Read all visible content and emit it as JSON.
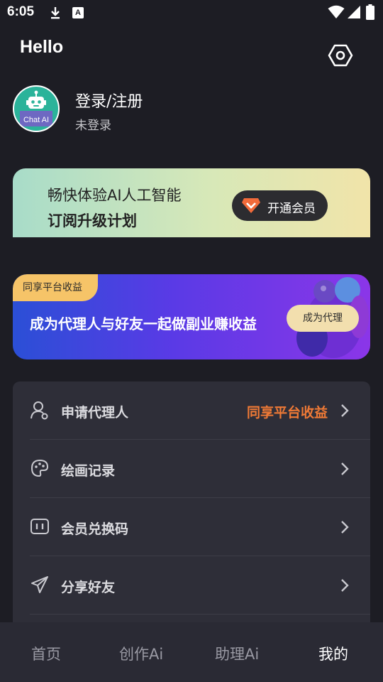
{
  "status_bar": {
    "time": "6:05",
    "icons": [
      "download-icon",
      "a-badge-icon",
      "wifi-icon",
      "signal-icon",
      "battery-icon"
    ],
    "a_glyph": "A"
  },
  "header": {
    "title": "Hello",
    "settings_icon": "hexagon-settings-icon"
  },
  "profile": {
    "avatar_label": "Chat AI",
    "login_title": "登录/注册",
    "login_status": "未登录"
  },
  "vip_banner": {
    "line1": "畅快体验AI人工智能",
    "line2": "订阅升级计划",
    "button_label": "开通会员",
    "accent": "#f26b3a"
  },
  "agent_banner": {
    "tag": "同享平台收益",
    "text": "成为代理人与好友一起做副业赚收益",
    "button_label": "成为代理"
  },
  "menu": {
    "items": [
      {
        "label": "申请代理人",
        "extra": "同享平台收益",
        "icon": "user-agent-icon"
      },
      {
        "label": "绘画记录",
        "extra": "",
        "icon": "palette-icon"
      },
      {
        "label": "会员兑换码",
        "extra": "",
        "icon": "redeem-code-icon"
      },
      {
        "label": "分享好友",
        "extra": "",
        "icon": "paper-plane-icon"
      }
    ]
  },
  "tabbar": {
    "tabs": [
      {
        "label": "首页"
      },
      {
        "label": "创作Ai"
      },
      {
        "label": "助理Ai"
      },
      {
        "label": "我的"
      }
    ],
    "active_index": 3
  }
}
